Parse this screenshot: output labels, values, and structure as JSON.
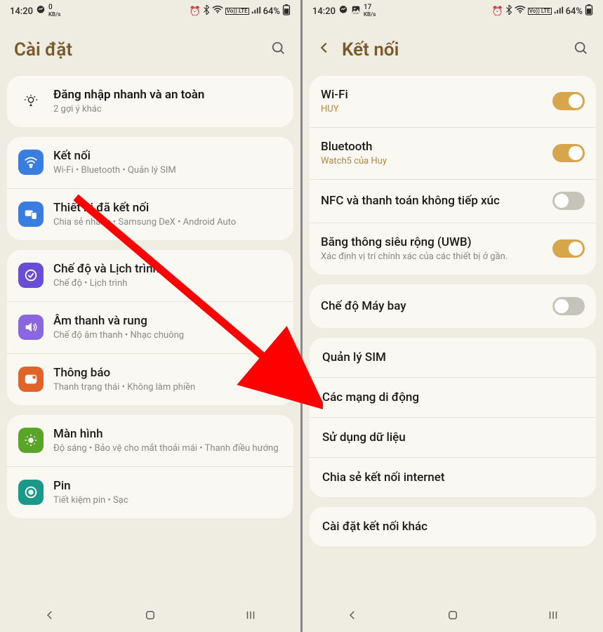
{
  "status": {
    "time": "14:20",
    "speed_left": "0",
    "speed_right": "17",
    "kbs": "KB/s",
    "battery": "64%",
    "volte": "Vo)) LTE"
  },
  "left": {
    "title": "Cài đặt",
    "tip": {
      "title": "Đăng nhập nhanh và an toàn",
      "sub": "2 gợi ý khác"
    },
    "items": [
      {
        "title": "Kết nối",
        "sub": "Wi-Fi  •  Bluetooth  •  Quản lý SIM"
      },
      {
        "title": "Thiết bị đã kết nối",
        "sub": "Chia sẻ nhanh  •  Samsung DeX  •  Android Auto"
      },
      {
        "title": "Chế độ và Lịch trình",
        "sub": "Chế độ  •  Lịch trình"
      },
      {
        "title": "Âm thanh và rung",
        "sub": "Chế độ âm thanh  •  Nhạc chuông"
      },
      {
        "title": "Thông báo",
        "sub": "Thanh trạng thái  •  Không làm phiền"
      },
      {
        "title": "Màn hình",
        "sub": "Độ sáng  •  Bảo vệ cho mắt thoải mái  •  Thanh điều hướng"
      },
      {
        "title": "Pin",
        "sub": "Tiết kiệm pin  •  Sạc"
      }
    ]
  },
  "right": {
    "title": "Kết nối",
    "items_a": [
      {
        "title": "Wi-Fi",
        "sub": "HUY",
        "on": true
      },
      {
        "title": "Bluetooth",
        "sub": "Watch5 của Huy",
        "on": true
      },
      {
        "title": "NFC và thanh toán không tiếp xúc",
        "sub": "",
        "on": false
      },
      {
        "title": "Băng thông siêu rộng (UWB)",
        "sub": "Xác định vị trí chính xác của các thiết bị ở gần.",
        "on": true
      }
    ],
    "airplane": {
      "title": "Chế độ Máy bay",
      "on": false
    },
    "items_b": [
      "Quản lý SIM",
      "Các mạng di động",
      "Sử dụng dữ liệu",
      "Chia sẻ kết nối internet"
    ],
    "items_c": [
      "Cài đặt kết nối khác"
    ]
  }
}
